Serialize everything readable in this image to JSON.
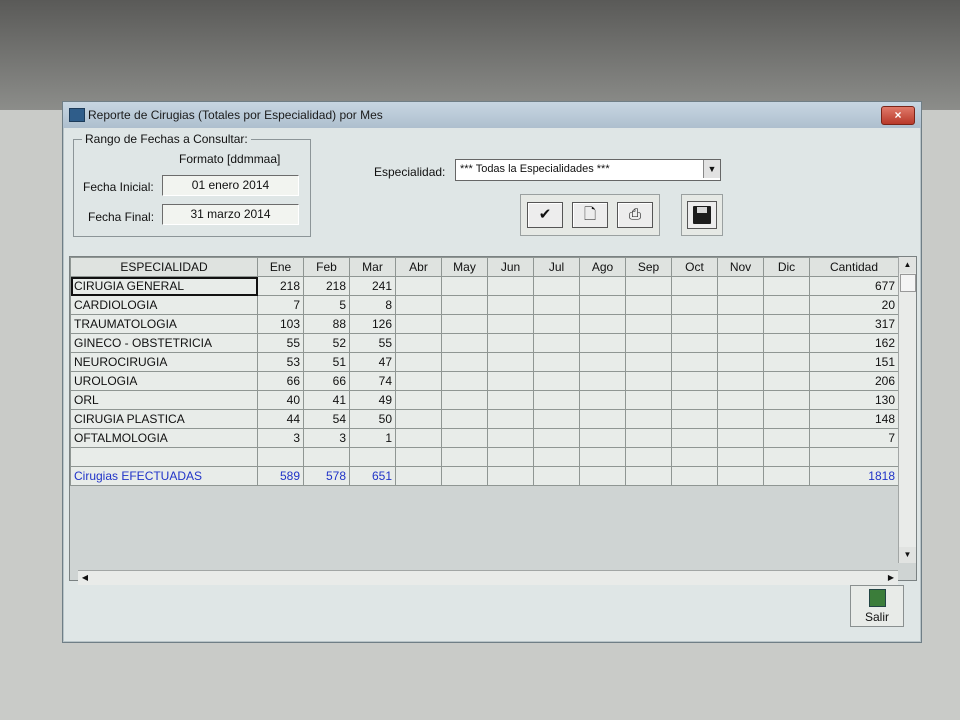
{
  "window": {
    "title": "Reporte de Cirugias (Totales por Especialidad) por Mes",
    "close_label": "×"
  },
  "date_range": {
    "legend": "Rango de Fechas a Consultar:",
    "format_label": "Formato [ddmmaa]",
    "start_label": "Fecha Inicial:",
    "start_value": "01 enero 2014",
    "end_label": "Fecha Final:",
    "end_value": "31 marzo 2014"
  },
  "specialty": {
    "label": "Especialidad:",
    "selected": "*** Todas la Especialidades ***"
  },
  "toolbar": {
    "buttons": [
      {
        "name": "accept-button",
        "icon": "check-icon"
      },
      {
        "name": "new-report-button",
        "icon": "document-icon"
      },
      {
        "name": "print-button",
        "icon": "printer-icon"
      }
    ],
    "save_icon": "floppy-disk-icon"
  },
  "grid": {
    "headers": [
      "ESPECIALIDAD",
      "Ene",
      "Feb",
      "Mar",
      "Abr",
      "May",
      "Jun",
      "Jul",
      "Ago",
      "Sep",
      "Oct",
      "Nov",
      "Dic",
      "Cantidad"
    ],
    "rows": [
      [
        "CIRUGIA GENERAL",
        "218",
        "218",
        "241",
        "",
        "",
        "",
        "",
        "",
        "",
        "",
        "",
        "",
        "677"
      ],
      [
        "CARDIOLOGIA",
        "7",
        "5",
        "8",
        "",
        "",
        "",
        "",
        "",
        "",
        "",
        "",
        "",
        "20"
      ],
      [
        "TRAUMATOLOGIA",
        "103",
        "88",
        "126",
        "",
        "",
        "",
        "",
        "",
        "",
        "",
        "",
        "",
        "317"
      ],
      [
        "GINECO - OBSTETRICIA",
        "55",
        "52",
        "55",
        "",
        "",
        "",
        "",
        "",
        "",
        "",
        "",
        "",
        "162"
      ],
      [
        "NEUROCIRUGIA",
        "53",
        "51",
        "47",
        "",
        "",
        "",
        "",
        "",
        "",
        "",
        "",
        "",
        "151"
      ],
      [
        "UROLOGIA",
        "66",
        "66",
        "74",
        "",
        "",
        "",
        "",
        "",
        "",
        "",
        "",
        "",
        "206"
      ],
      [
        "ORL",
        "40",
        "41",
        "49",
        "",
        "",
        "",
        "",
        "",
        "",
        "",
        "",
        "",
        "130"
      ],
      [
        "CIRUGIA PLASTICA",
        "44",
        "54",
        "50",
        "",
        "",
        "",
        "",
        "",
        "",
        "",
        "",
        "",
        "148"
      ],
      [
        "OFTALMOLOGIA",
        "3",
        "3",
        "1",
        "",
        "",
        "",
        "",
        "",
        "",
        "",
        "",
        "",
        "7"
      ]
    ],
    "total_row": [
      "Cirugias EFECTUADAS",
      "589",
      "578",
      "651",
      "",
      "",
      "",
      "",
      "",
      "",
      "",
      "",
      "",
      "1818"
    ],
    "total_color": "#2033c8"
  },
  "exit": {
    "label": "Salir",
    "icon": "door-exit-icon"
  }
}
